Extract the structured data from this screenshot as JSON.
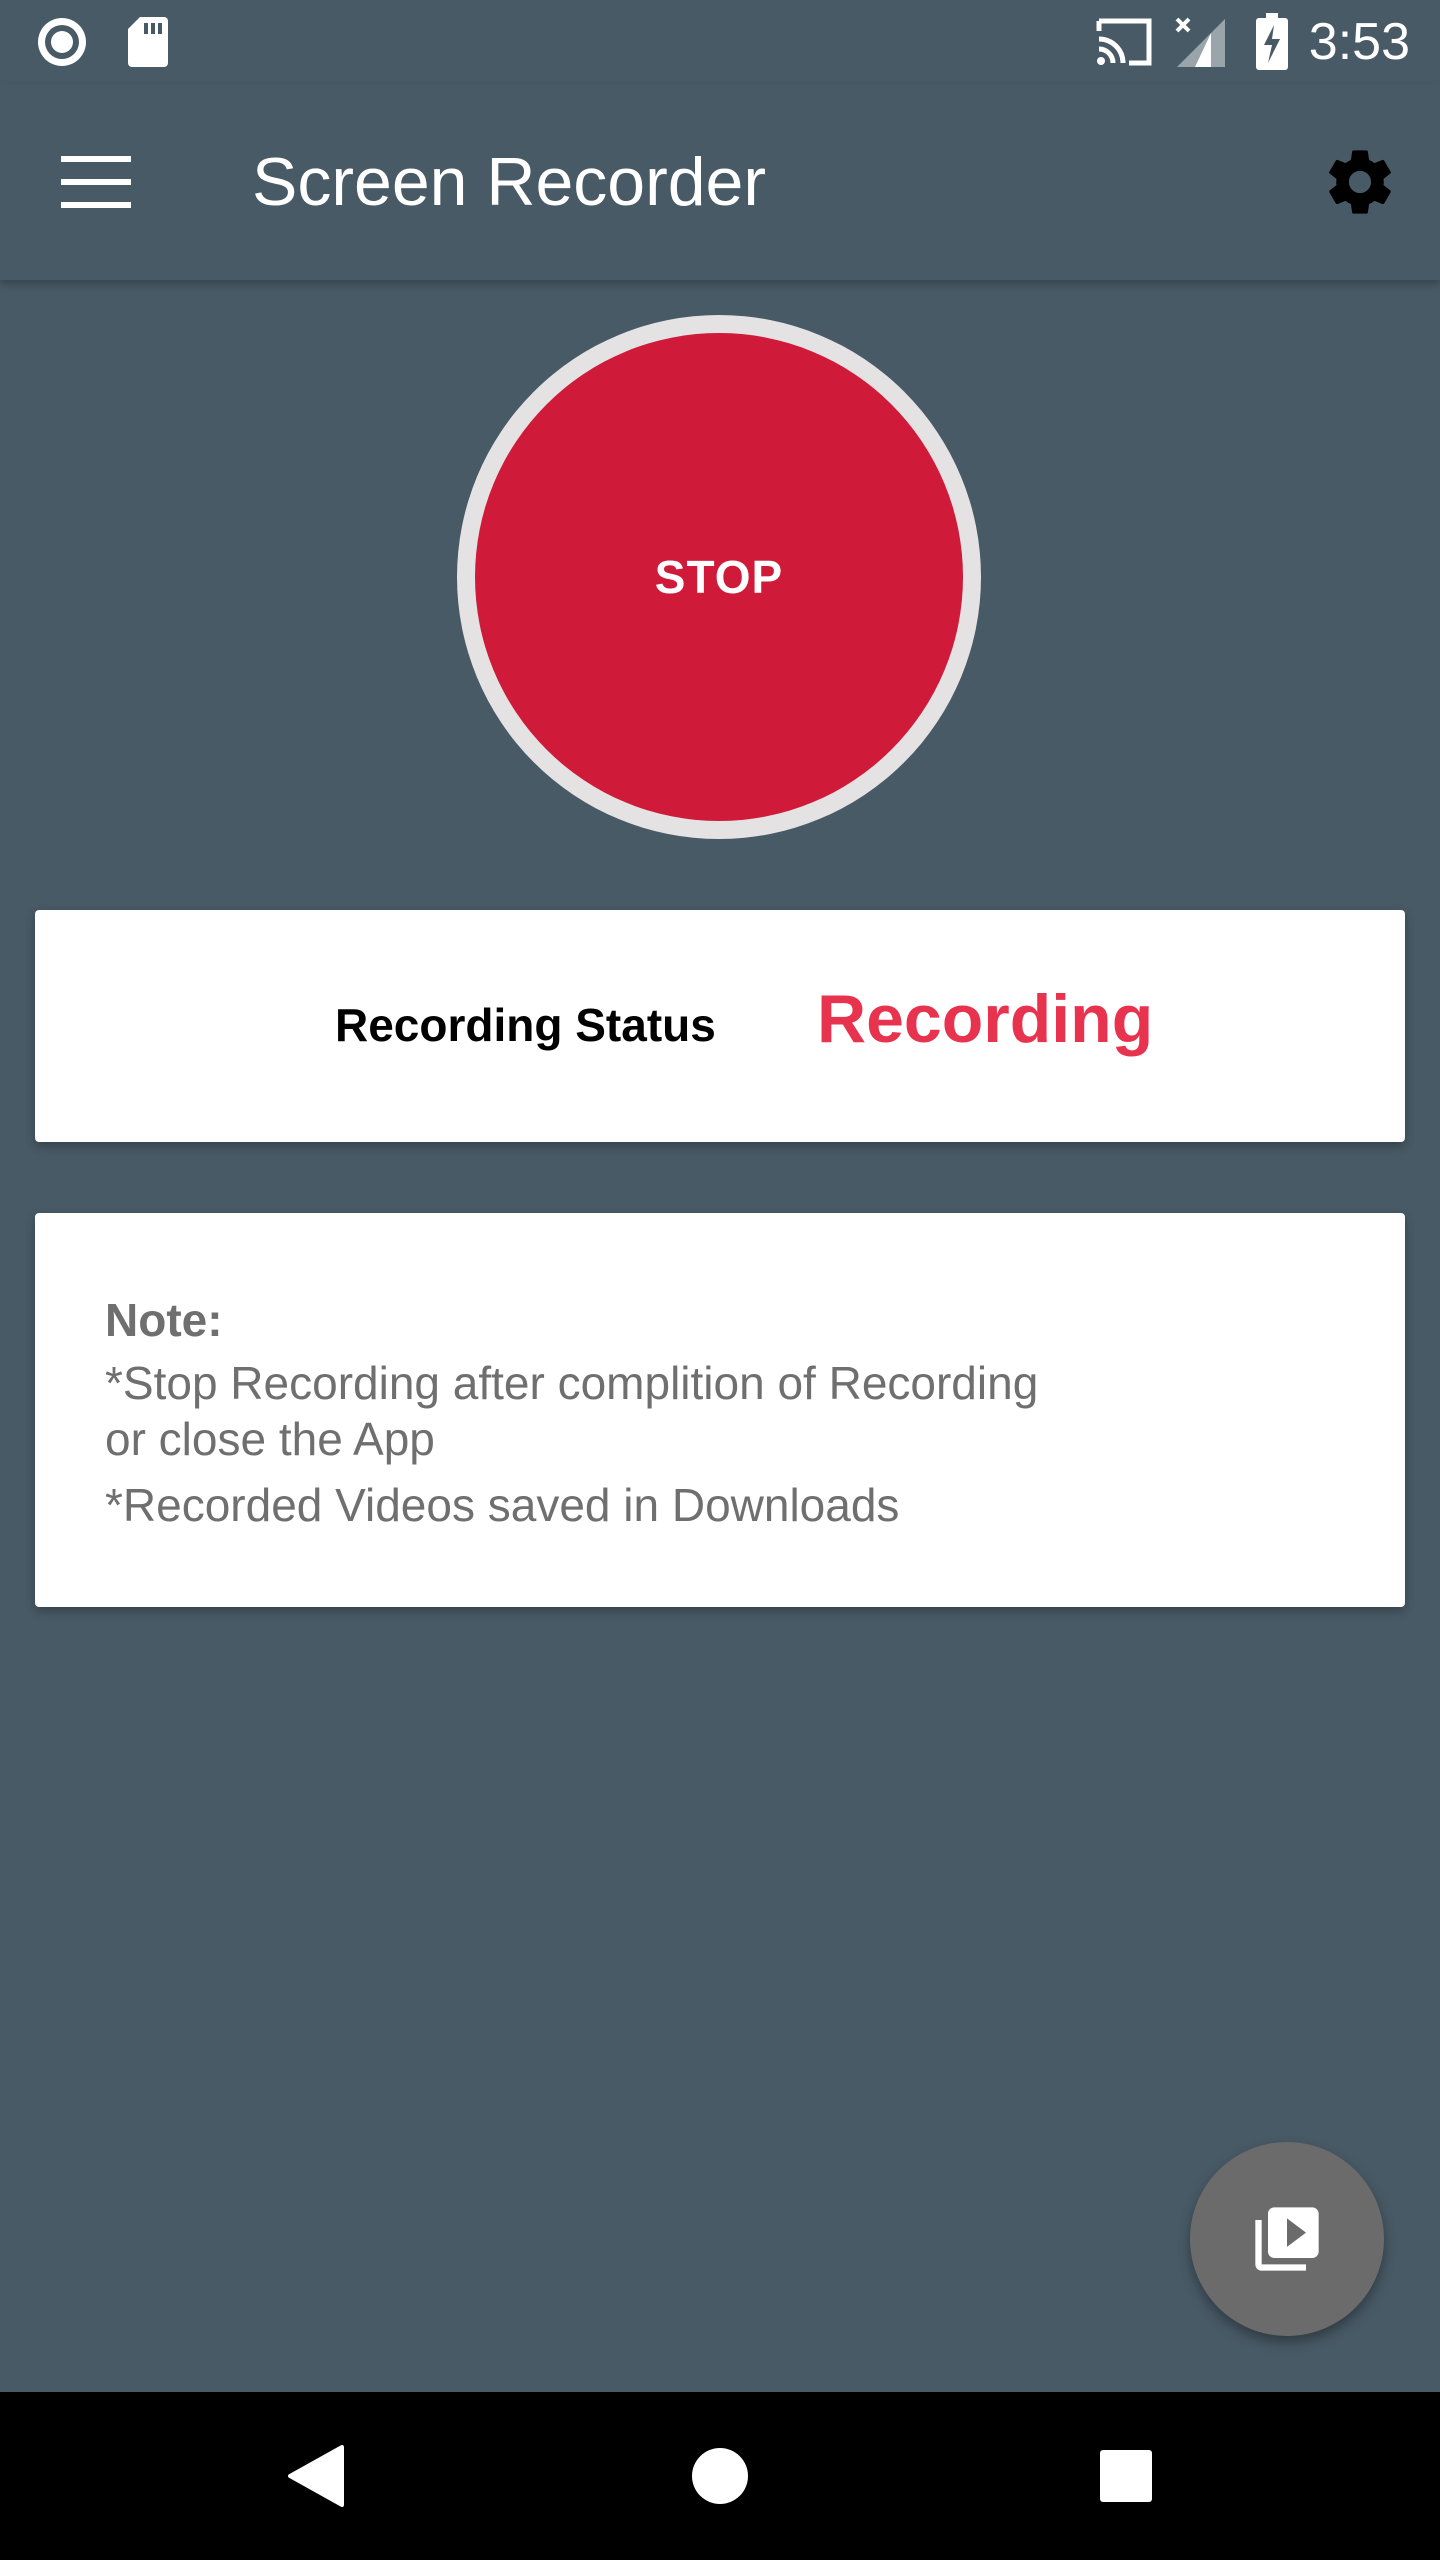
{
  "status_bar": {
    "time": "3:53",
    "icons": [
      "screen-record-indicator-icon",
      "sd-card-icon",
      "cast-icon",
      "no-signal-icon",
      "battery-charging-icon"
    ]
  },
  "app_bar": {
    "title": "Screen Recorder",
    "menu_icon": "hamburger-menu-icon",
    "settings_icon": "gear-icon"
  },
  "record_button": {
    "label": "STOP",
    "color": "#cf1a39",
    "ring_color": "#e4e2e3"
  },
  "status_card": {
    "label": "Recording Status",
    "value": "Recording",
    "value_color": "#e8334f"
  },
  "note_card": {
    "title": "Note:",
    "line1": "*Stop Recording after complition of Recording",
    "line2": "or close the App",
    "line3": "*Recorded Videos saved in Downloads"
  },
  "fab": {
    "icon": "video-library-icon"
  },
  "nav_bar": {
    "back_icon": "back-triangle-icon",
    "home_icon": "home-circle-icon",
    "recents_icon": "recents-square-icon"
  },
  "colors": {
    "background": "#485a66",
    "card": "#ffffff",
    "fab": "#6b6b6b"
  }
}
